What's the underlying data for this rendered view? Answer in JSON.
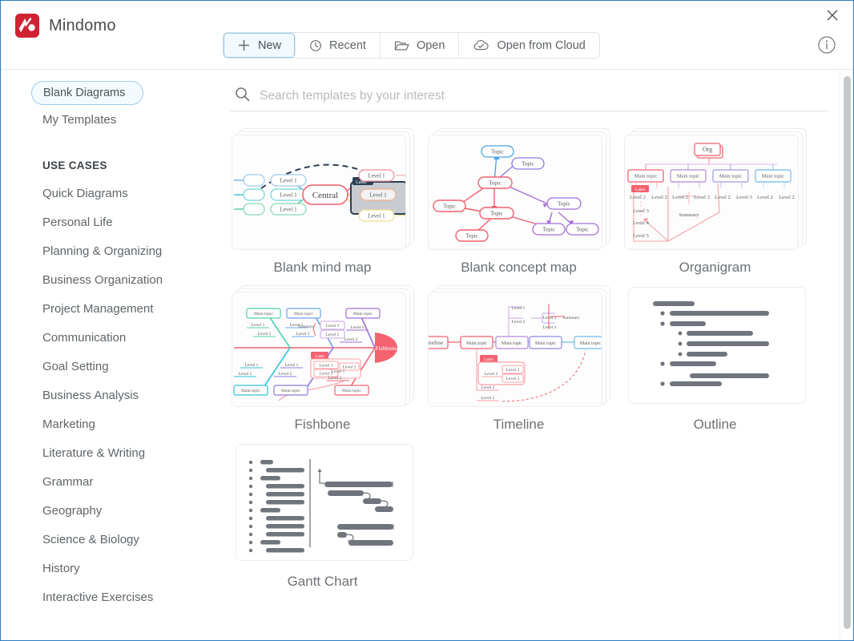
{
  "window": {
    "app_name": "Mindomo",
    "close_label": "×",
    "info_label": "i"
  },
  "toolbar": {
    "tabs": [
      {
        "label": "New",
        "icon": "plus-icon",
        "active": true
      },
      {
        "label": "Recent",
        "icon": "clock-icon",
        "active": false
      },
      {
        "label": "Open",
        "icon": "folder-open-icon",
        "active": false
      },
      {
        "label": "Open from Cloud",
        "icon": "cloud-check-icon",
        "active": false
      }
    ]
  },
  "search": {
    "placeholder": "Search templates by your interest",
    "value": "",
    "icon": "search-icon"
  },
  "sidebar": {
    "top_items": [
      {
        "label": "Blank Diagrams",
        "selected": true
      },
      {
        "label": "My Templates",
        "selected": false
      }
    ],
    "section_title": "USE CASES",
    "use_cases": [
      {
        "label": "Quick Diagrams"
      },
      {
        "label": "Personal Life"
      },
      {
        "label": "Planning & Organizing"
      },
      {
        "label": "Business Organization"
      },
      {
        "label": "Project Management"
      },
      {
        "label": "Communication"
      },
      {
        "label": "Goal Setting"
      },
      {
        "label": "Business Analysis"
      },
      {
        "label": "Marketing"
      },
      {
        "label": "Literature & Writing"
      },
      {
        "label": "Grammar"
      },
      {
        "label": "Geography"
      },
      {
        "label": "Science & Biology"
      },
      {
        "label": "History"
      },
      {
        "label": "Interactive Exercises"
      }
    ]
  },
  "templates": [
    {
      "id": "blank-mind-map",
      "label": "Blank mind map",
      "thumb": "mindmap",
      "stacked": true
    },
    {
      "id": "blank-concept-map",
      "label": "Blank concept map",
      "thumb": "conceptmap",
      "stacked": true
    },
    {
      "id": "organigram",
      "label": "Organigram",
      "thumb": "organigram",
      "stacked": true
    },
    {
      "id": "fishbone",
      "label": "Fishbone",
      "thumb": "fishbone",
      "stacked": true
    },
    {
      "id": "timeline",
      "label": "Timeline",
      "thumb": "timeline",
      "stacked": true
    },
    {
      "id": "outline",
      "label": "Outline",
      "thumb": "outline",
      "stacked": false
    },
    {
      "id": "gantt-chart",
      "label": "Gantt Chart",
      "thumb": "gantt",
      "stacked": false
    }
  ],
  "thumb_text": {
    "central": "Central",
    "level1": "Level 1",
    "label": "Label",
    "topic": "Topic",
    "org": "Org",
    "main_topic": "Main topic",
    "level2": "Level 2",
    "level3": "Level 3",
    "level4": "Level 4",
    "level5": "Level 5",
    "summary": "Summary",
    "fishbone": "Fishbone",
    "timeline": "Timeline"
  },
  "colors": {
    "accent": "#2b7cc0",
    "brand_red": "#cf2233",
    "pill_border": "#9bcdf0",
    "text": "#5f6569",
    "caption": "#6c7175"
  }
}
